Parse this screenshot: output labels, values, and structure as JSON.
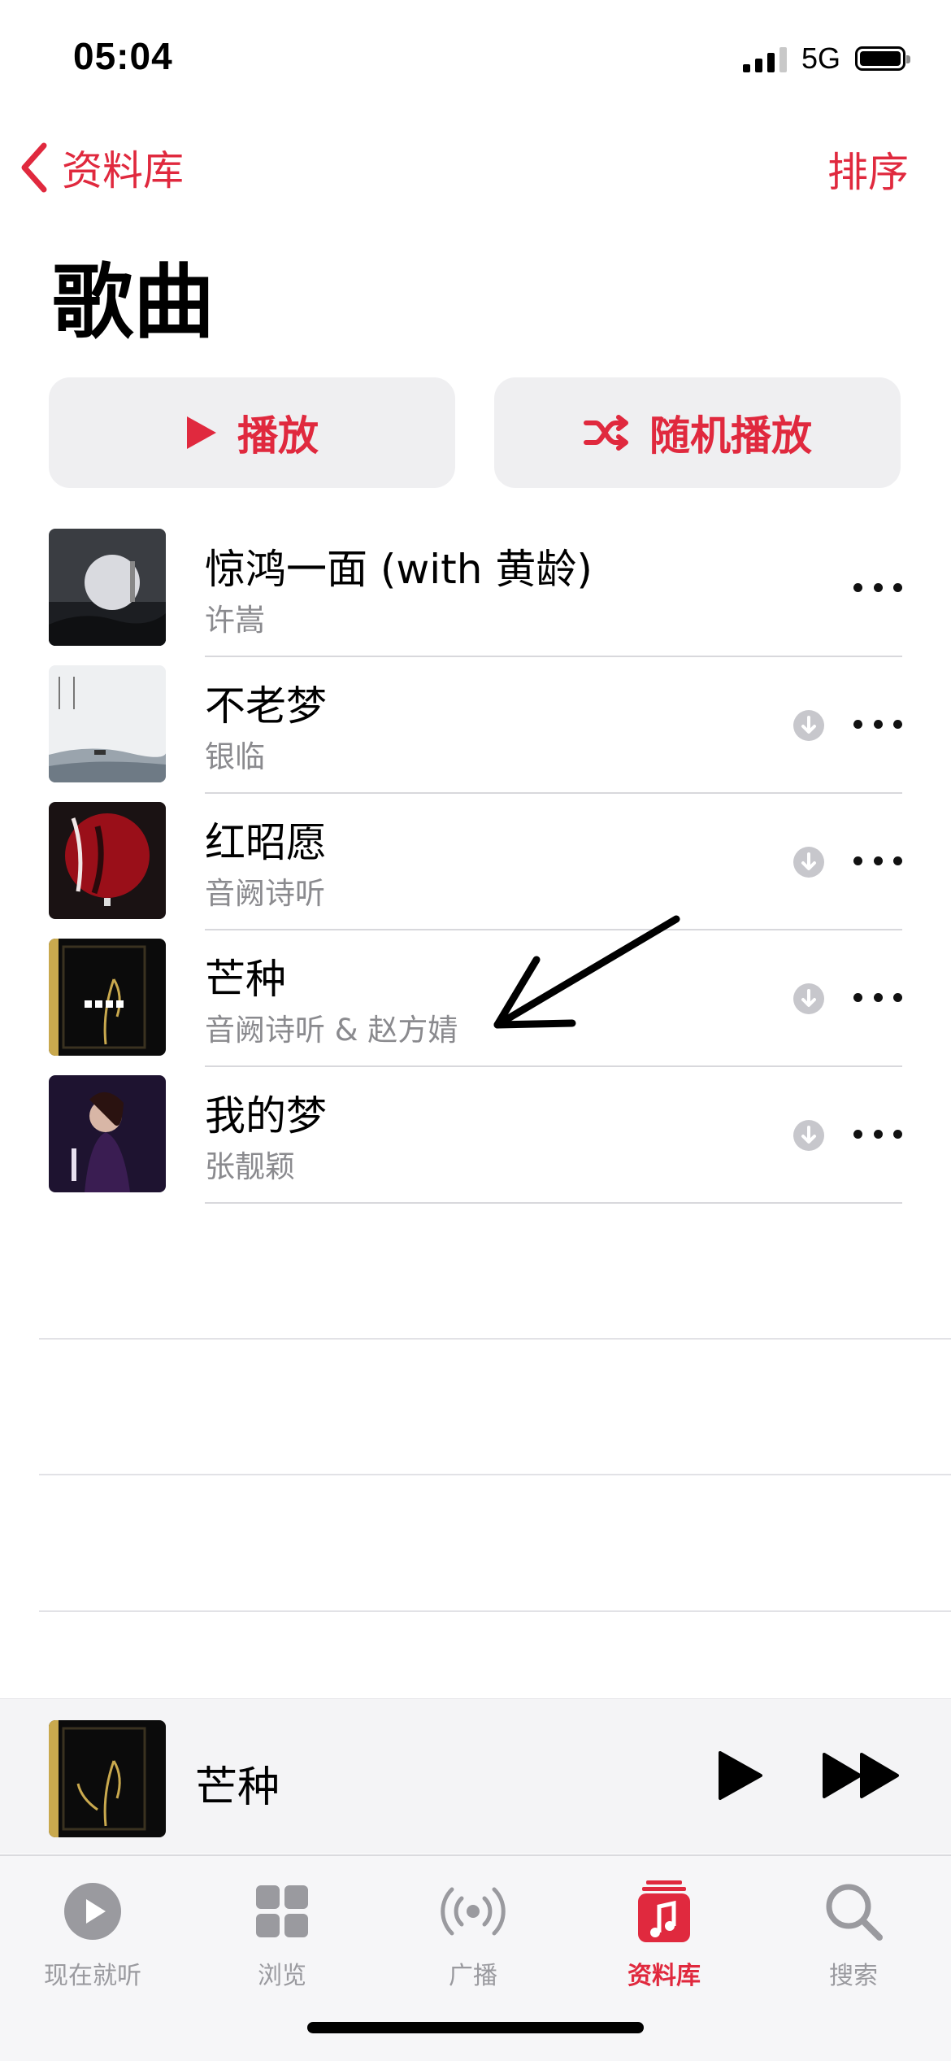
{
  "status_bar": {
    "time": "05:04",
    "network": "5G"
  },
  "nav": {
    "back_label": "资料库",
    "sort_label": "排序"
  },
  "page": {
    "title": "歌曲"
  },
  "actions": {
    "play_label": "播放",
    "shuffle_label": "随机播放"
  },
  "songs": [
    {
      "title": "惊鸿一面 (with 黄龄)",
      "artist": "许嵩",
      "downloadable": false
    },
    {
      "title": "不老梦",
      "artist": "银临",
      "downloadable": true
    },
    {
      "title": "红昭愿",
      "artist": "音阙诗听",
      "downloadable": true
    },
    {
      "title": "芒种",
      "artist": "音阙诗听 & 赵方婧",
      "downloadable": true
    },
    {
      "title": "我的梦",
      "artist": "张靓颖",
      "downloadable": true
    }
  ],
  "now_playing": {
    "title": "芒种"
  },
  "tabs": [
    {
      "label": "现在就听",
      "icon": "play-circle-icon",
      "active": false
    },
    {
      "label": "浏览",
      "icon": "grid-icon",
      "active": false
    },
    {
      "label": "广播",
      "icon": "radio-icon",
      "active": false
    },
    {
      "label": "资料库",
      "icon": "music-library-icon",
      "active": true
    },
    {
      "label": "搜索",
      "icon": "search-icon",
      "active": false
    }
  ],
  "colors": {
    "accent": "#e0293e",
    "secondary_text": "#8a8a8e",
    "button_bg": "#efeff1"
  }
}
